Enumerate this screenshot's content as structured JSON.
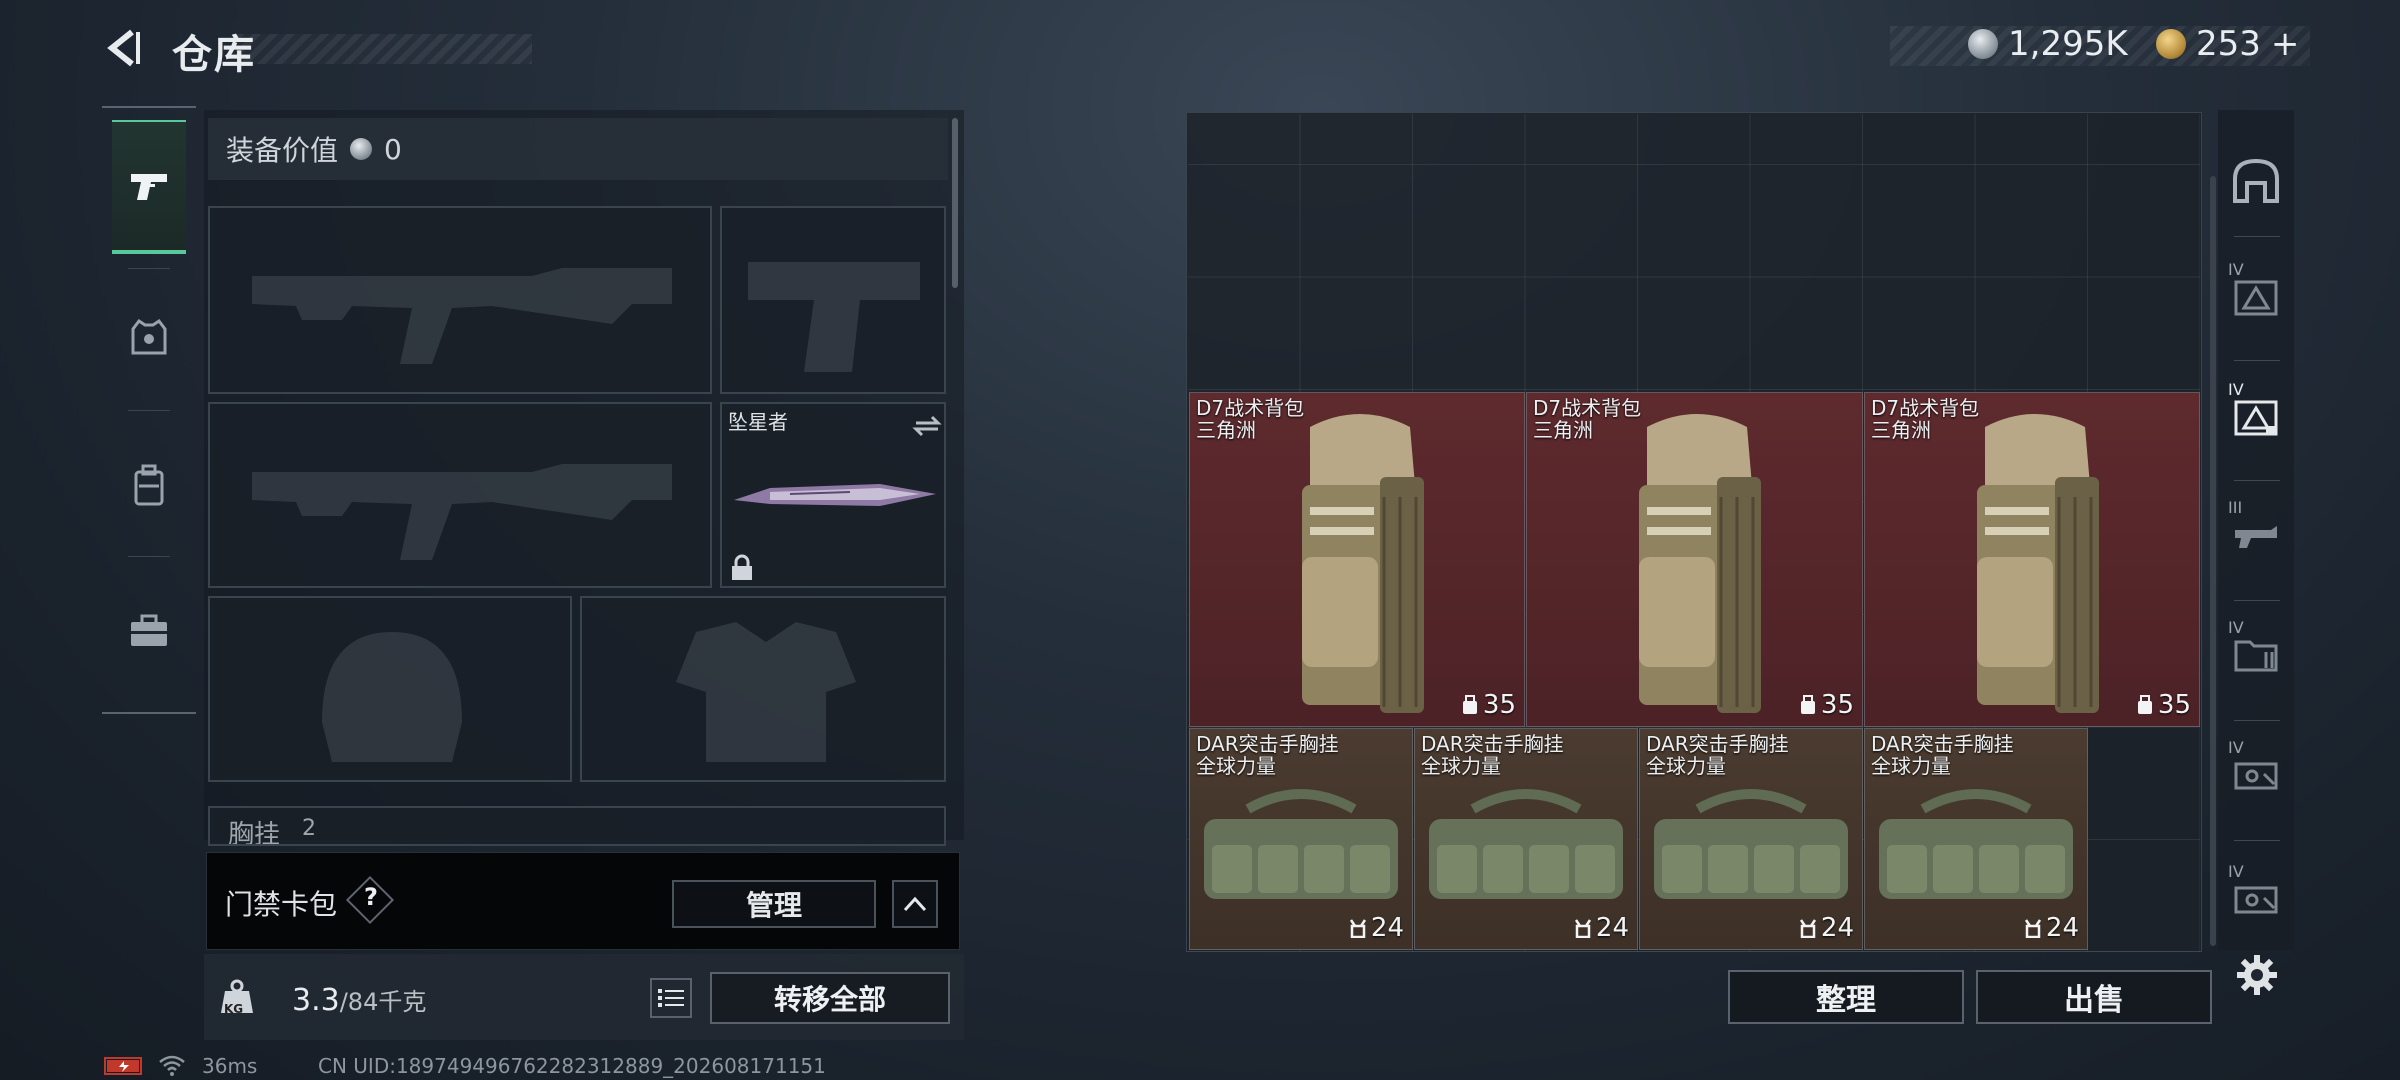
{
  "header": {
    "title": "仓库",
    "currencies": [
      {
        "name": "hafu-coin",
        "value": "1,295K",
        "icon": "silver-coin-icon",
        "color": "#b9c2c9"
      },
      {
        "name": "triangle-coin",
        "value": "253",
        "suffix": "+",
        "icon": "gold-coin-icon",
        "color": "#c9a456"
      }
    ]
  },
  "rail": {
    "items": [
      {
        "name": "weapons",
        "icon": "pistol-icon",
        "active": true
      },
      {
        "name": "armor",
        "icon": "vest-icon",
        "active": false
      },
      {
        "name": "backpack",
        "icon": "backpack-icon",
        "active": false
      },
      {
        "name": "toolkit",
        "icon": "toolbox-icon",
        "active": false
      }
    ]
  },
  "loadout": {
    "equip_value_label": "装备价值",
    "equip_value": "0",
    "melee_name": "坠星者",
    "chest_rig_label": "胸挂",
    "chest_rig_count": "2",
    "card_pack_label": "门禁卡包",
    "help_label": "?",
    "manage_label": "管理",
    "weight_value": "3.3",
    "weight_max": "/84千克",
    "transfer_all_label": "转移全部",
    "weight_icon_text": "KG"
  },
  "status": {
    "ping": "36ms",
    "uid": "CN UID:1897494967622823128​89_202608171151"
  },
  "stash": {
    "items": [
      {
        "name": "D7战术背包",
        "sub": "三角洲",
        "count": "35",
        "type": "bag"
      },
      {
        "name": "D7战术背包",
        "sub": "三角洲",
        "count": "35",
        "type": "bag"
      },
      {
        "name": "D7战术背包",
        "sub": "三角洲",
        "count": "35",
        "type": "bag"
      },
      {
        "name": "DAR突击手胸挂",
        "sub": "全球力量",
        "count": "24",
        "type": "rig"
      },
      {
        "name": "DAR突击手胸挂",
        "sub": "全球力量",
        "count": "24",
        "type": "rig"
      },
      {
        "name": "DAR突击手胸挂",
        "sub": "全球力量",
        "count": "24",
        "type": "rig"
      },
      {
        "name": "DAR突击手胸挂",
        "sub": "全球力量",
        "count": "24",
        "type": "rig"
      }
    ],
    "sort_label": "整理",
    "sell_label": "出售"
  },
  "right_rail": {
    "items": [
      {
        "name": "all",
        "icon": "arch-icon",
        "tier": ""
      },
      {
        "name": "iv-tactical",
        "icon": "tier-triangle-icon",
        "tier": "IV"
      },
      {
        "name": "iv-tactical-locked",
        "icon": "tier-triangle-lock-icon",
        "tier": "IV"
      },
      {
        "name": "iii-weapon",
        "icon": "gun-case-icon",
        "tier": "III"
      },
      {
        "name": "iv-folder",
        "icon": "folder-icon",
        "tier": "IV"
      },
      {
        "name": "iv-box",
        "icon": "crate-icon",
        "tier": "IV"
      },
      {
        "name": "iv-box-2",
        "icon": "crate-icon",
        "tier": "IV"
      }
    ],
    "settings_icon": "gear-icon"
  }
}
